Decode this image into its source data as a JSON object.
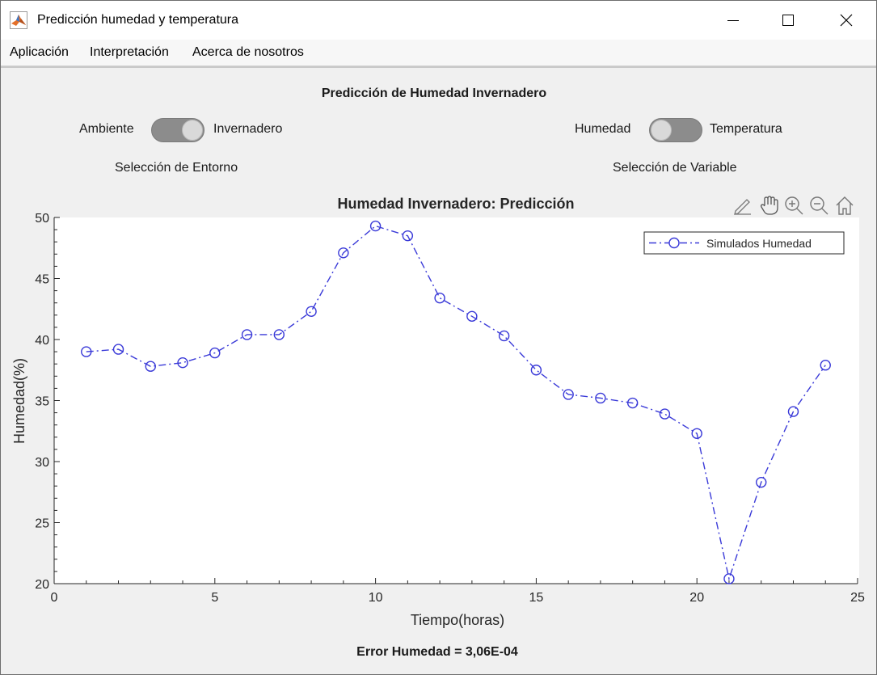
{
  "window": {
    "title": "Predicción humedad y temperatura"
  },
  "menu": [
    "Aplicación",
    "Interpretación",
    "Acerca de nosotros"
  ],
  "panel": {
    "title": "Predicción de Humedad Invernadero",
    "env_switch": {
      "left": "Ambiente",
      "right": "Invernadero",
      "state": "Invernadero",
      "caption": "Selección de Entorno"
    },
    "var_switch": {
      "left": "Humedad",
      "right": "Temperatura",
      "state": "Humedad",
      "caption": "Selección de Variable"
    },
    "error_text": "Error Humedad = 3,06E-04"
  },
  "toolbar_icons": [
    "annotate-icon",
    "pan-hand-icon",
    "zoom-in-icon",
    "zoom-out-icon",
    "home-icon"
  ],
  "chart_data": {
    "type": "line",
    "title": "Humedad Invernadero: Predicción",
    "xlabel": "Tiempo(horas)",
    "ylabel": "Humedad(%)",
    "xlim": [
      0,
      25
    ],
    "ylim": [
      20,
      50
    ],
    "xticks": [
      0,
      5,
      10,
      15,
      20,
      25
    ],
    "yticks": [
      20,
      25,
      30,
      35,
      40,
      45,
      50
    ],
    "legend_position": "top-right",
    "grid": false,
    "series": [
      {
        "name": "Simulados Humedad",
        "color": "#3a3ad8",
        "line_style": "dash-dot",
        "marker": "circle",
        "x": [
          1,
          2,
          3,
          4,
          5,
          6,
          7,
          8,
          9,
          10,
          11,
          12,
          13,
          14,
          15,
          16,
          17,
          18,
          19,
          20,
          21,
          22,
          23,
          24
        ],
        "y": [
          39.0,
          39.2,
          37.8,
          38.1,
          38.9,
          40.4,
          40.4,
          42.3,
          47.1,
          49.3,
          48.5,
          43.4,
          41.9,
          40.3,
          37.5,
          35.5,
          35.2,
          34.8,
          33.9,
          32.3,
          20.4,
          28.3,
          34.1,
          37.9
        ]
      }
    ]
  }
}
